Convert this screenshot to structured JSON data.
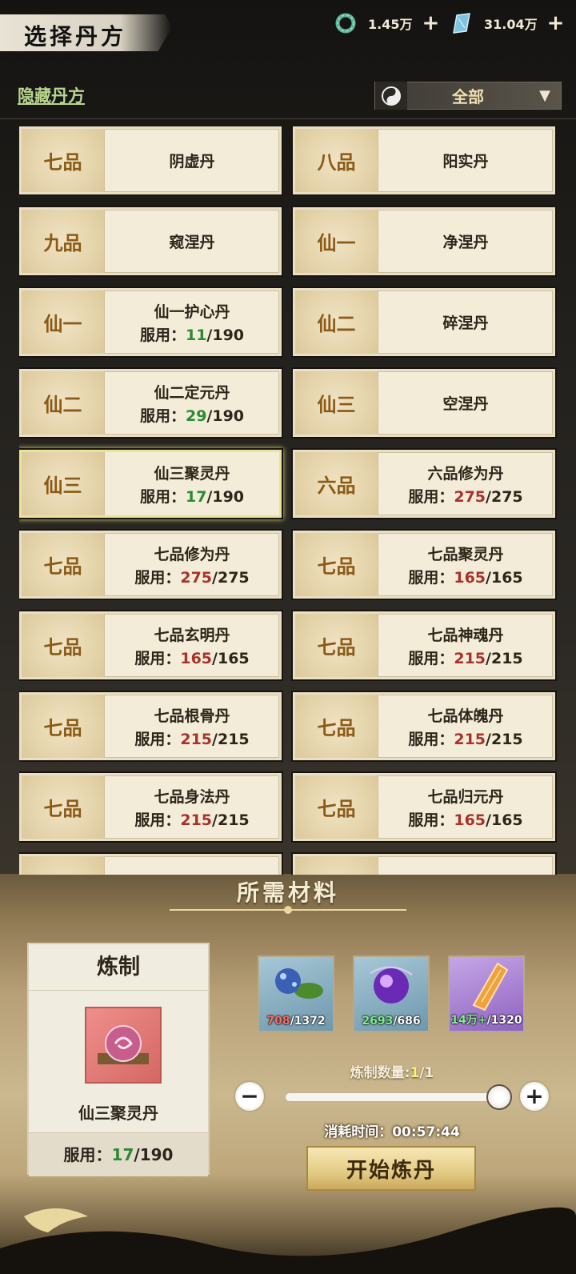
{
  "header": {
    "title": "选择丹方",
    "currency1": {
      "icon": "jade-ring-icon",
      "value": "1.45万",
      "plus": "+"
    },
    "currency2": {
      "icon": "crystal-icon",
      "value": "31.04万",
      "plus": "+"
    }
  },
  "toolbar": {
    "hidden_recipes_label": "隐藏丹方",
    "filter_value": "全部",
    "filter_icon": "yin-yang-icon"
  },
  "recipes": [
    {
      "grade": "七品",
      "name": "阴虚丹"
    },
    {
      "grade": "八品",
      "name": "阳实丹"
    },
    {
      "grade": "九品",
      "name": "窥涅丹"
    },
    {
      "grade": "仙一",
      "name": "净涅丹"
    },
    {
      "grade": "仙一",
      "name": "仙一护心丹",
      "use_label": "服用：",
      "used": "11",
      "max": "/190",
      "status": "ok"
    },
    {
      "grade": "仙二",
      "name": "碎涅丹"
    },
    {
      "grade": "仙二",
      "name": "仙二定元丹",
      "use_label": "服用：",
      "used": "29",
      "max": "/190",
      "status": "ok"
    },
    {
      "grade": "仙三",
      "name": "空涅丹"
    },
    {
      "grade": "仙三",
      "name": "仙三聚灵丹",
      "use_label": "服用：",
      "used": "17",
      "max": "/190",
      "status": "ok",
      "selected": true
    },
    {
      "grade": "六品",
      "name": "六品修为丹",
      "use_label": "服用：",
      "used": "275",
      "max": "/275",
      "status": "full"
    },
    {
      "grade": "七品",
      "name": "七品修为丹",
      "use_label": "服用：",
      "used": "275",
      "max": "/275",
      "status": "full"
    },
    {
      "grade": "七品",
      "name": "七品聚灵丹",
      "use_label": "服用：",
      "used": "165",
      "max": "/165",
      "status": "full"
    },
    {
      "grade": "七品",
      "name": "七品玄明丹",
      "use_label": "服用：",
      "used": "165",
      "max": "/165",
      "status": "full"
    },
    {
      "grade": "七品",
      "name": "七品神魂丹",
      "use_label": "服用：",
      "used": "215",
      "max": "/215",
      "status": "full"
    },
    {
      "grade": "七品",
      "name": "七品根骨丹",
      "use_label": "服用：",
      "used": "215",
      "max": "/215",
      "status": "full"
    },
    {
      "grade": "七品",
      "name": "七品体魄丹",
      "use_label": "服用：",
      "used": "215",
      "max": "/215",
      "status": "full"
    },
    {
      "grade": "七品",
      "name": "七品身法丹",
      "use_label": "服用：",
      "used": "215",
      "max": "/215",
      "status": "full"
    },
    {
      "grade": "七品",
      "name": "七品归元丹",
      "use_label": "服用：",
      "used": "165",
      "max": "/165",
      "status": "full"
    },
    {
      "grade": "",
      "name": ""
    },
    {
      "grade": "",
      "name": ""
    }
  ],
  "panel": {
    "title": "所需材料",
    "refine": {
      "title": "炼制",
      "pill_icon": "pill-orb-icon",
      "pill_name": "仙三聚灵丹",
      "use_label": "服用：",
      "used": "17",
      "max": "/190"
    },
    "materials": [
      {
        "icon": "blue-herb-icon",
        "have": "708",
        "need": "/1372",
        "status": "short"
      },
      {
        "icon": "purple-orb-icon",
        "have": "2693",
        "need": "/686",
        "status": "ok"
      },
      {
        "icon": "amber-crystal-icon",
        "have": "14万+",
        "need": "/1320",
        "status": "ok"
      }
    ],
    "quantity_label": "炼制数量:",
    "quantity_current": "1",
    "quantity_max": "/1",
    "quantity_fraction": 1.0,
    "minus": "−",
    "plus": "+",
    "time_label": "消耗时间：",
    "time_value": "00:57:44",
    "start_button": "开始炼丹"
  },
  "colors": {
    "ok_green": "#2b8a33",
    "full_red": "#a8332b",
    "grade_brown": "#8a5a16",
    "accent_gold": "#e4cb84"
  }
}
